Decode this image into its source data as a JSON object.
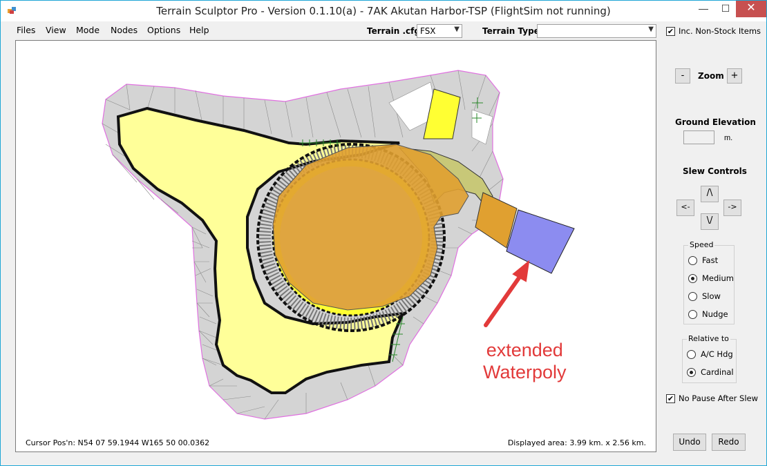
{
  "window": {
    "title": "Terrain Sculptor Pro - Version 0.1.10(a) - 7AK Akutan Harbor-TSP (FlightSim not running)",
    "minimize_glyph": "—",
    "maximize_glyph": "☐",
    "close_glyph": "✕"
  },
  "menu": {
    "items": [
      {
        "label": "Files"
      },
      {
        "label": "View"
      },
      {
        "label": "Mode"
      },
      {
        "label": "Nodes"
      },
      {
        "label": "Options"
      },
      {
        "label": "Help"
      }
    ]
  },
  "toolbar": {
    "terrain_cfg_label": "Terrain .cfg",
    "terrain_cfg_value": "FSX",
    "terrain_type_label": "Terrain Type",
    "terrain_type_value": "",
    "inc_nonstock_label": "Inc. Non-Stock Items",
    "inc_nonstock_checked": true,
    "dropdown_glyph": "▼",
    "check_glyph": "✔"
  },
  "side_panel": {
    "zoom_label": "Zoom",
    "zoom_out": "-",
    "zoom_in": "+",
    "ground_elevation_label": "Ground Elevation",
    "ground_elevation_value": "",
    "ground_elevation_unit": "m.",
    "slew_controls_label": "Slew Controls",
    "slew_up": "/\\",
    "slew_left": "<-",
    "slew_right": "->",
    "slew_down": "\\/",
    "speed_group": {
      "title": "Speed",
      "options": [
        "Fast",
        "Medium",
        "Slow",
        "Nudge"
      ],
      "selected": "Medium"
    },
    "relative_group": {
      "title": "Relative to",
      "options": [
        "A/C Hdg",
        "Cardinal"
      ],
      "selected": "Cardinal"
    },
    "no_pause_label": "No Pause After Slew",
    "no_pause_checked": true,
    "undo_label": "Undo",
    "redo_label": "Redo"
  },
  "canvas": {
    "cursor_position": "Cursor Pos'n: N54 07 59.1944 W165 50 00.0362",
    "displayed_area": "Displayed area: 3.99 km. x 2.56 km.",
    "annotation_line1": "extended",
    "annotation_line2": "Waterpoly",
    "colors": {
      "mesh_fill": "#d4d4d4",
      "mesh_edge": "#777777",
      "outer_vertex": "#e070e0",
      "land_fill": "#ffff99",
      "water_fill": "#e0a030",
      "water_ext_fill": "#8c8cf0",
      "yellow_fill": "#ffff33",
      "olive_fill": "#c8c878",
      "annotation": "#e23a3a"
    }
  }
}
